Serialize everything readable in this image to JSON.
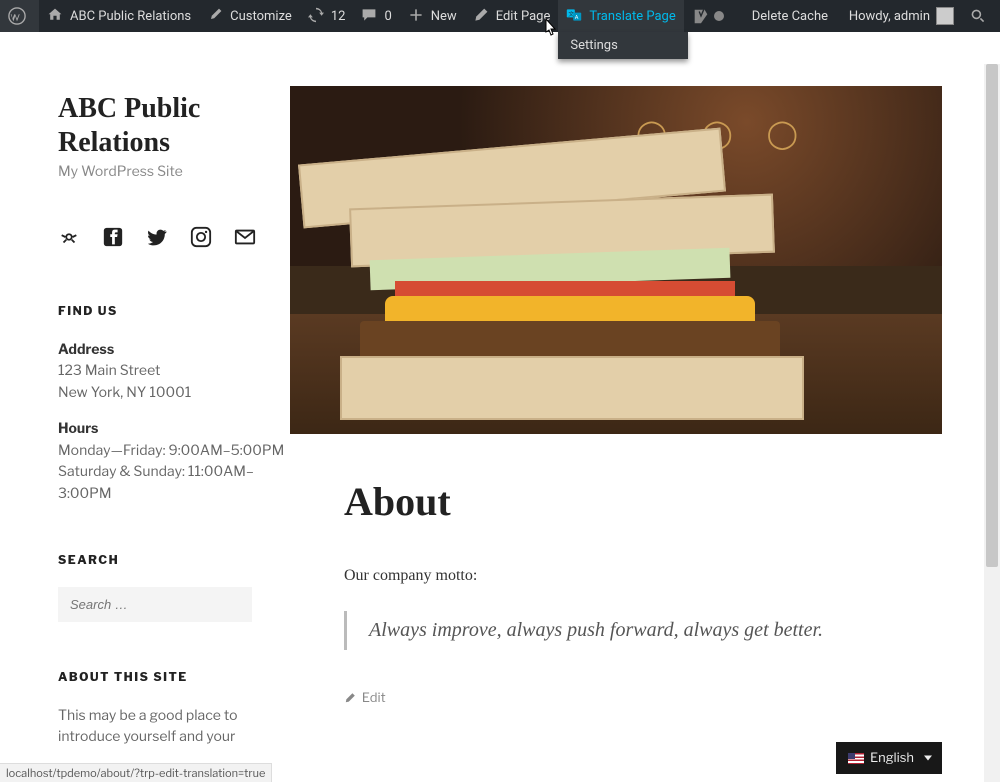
{
  "adminbar": {
    "site_name": "ABC Public Relations",
    "customize": "Customize",
    "updates_count": "12",
    "comments_count": "0",
    "new_label": "New",
    "edit_page": "Edit Page",
    "translate_page": "Translate Page",
    "translate_settings": "Settings",
    "delete_cache": "Delete Cache",
    "howdy": "Howdy, admin",
    "search_title": "Search"
  },
  "site": {
    "title": "ABC Public Relations",
    "tagline": "My WordPress Site"
  },
  "findus": {
    "title": "FIND US",
    "address_label": "Address",
    "address_line1": "123 Main Street",
    "address_line2": "New York, NY 10001",
    "hours_label": "Hours",
    "hours_line1": "Monday—Friday: 9:00AM–5:00PM",
    "hours_line2": "Saturday & Sunday: 11:00AM–3:00PM"
  },
  "search": {
    "title": "SEARCH",
    "placeholder": "Search …"
  },
  "about_widget": {
    "title": "ABOUT THIS SITE",
    "text": "This may be a good place to introduce yourself and your"
  },
  "article": {
    "title": "About",
    "intro": "Our company motto:",
    "quote": "Always improve, always push forward, always get better.",
    "edit": "Edit"
  },
  "lang": {
    "label": "English"
  },
  "status_url": "localhost/tpdemo/about/?trp-edit-translation=true"
}
